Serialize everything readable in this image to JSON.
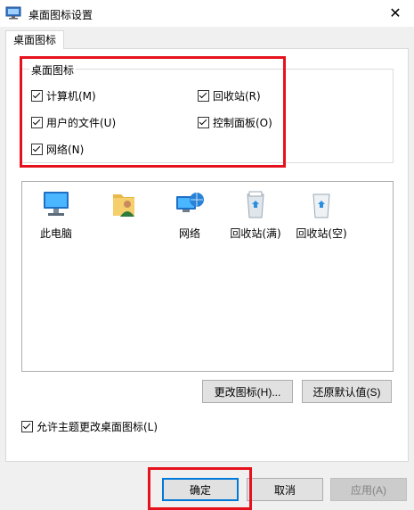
{
  "window": {
    "title": "桌面图标设置",
    "close_glyph": "✕"
  },
  "tabs": [
    {
      "label": "桌面图标",
      "selected": true
    }
  ],
  "group": {
    "legend": "桌面图标",
    "checkboxes": [
      {
        "label": "计算机(M)",
        "checked": true
      },
      {
        "label": "回收站(R)",
        "checked": true
      },
      {
        "label": "用户的文件(U)",
        "checked": true
      },
      {
        "label": "控制面板(O)",
        "checked": true
      },
      {
        "label": "网络(N)",
        "checked": true
      }
    ]
  },
  "icons": [
    {
      "label": "此电脑",
      "icon": "computer-icon"
    },
    {
      "label": "",
      "icon": "user-folder-icon"
    },
    {
      "label": "网络",
      "icon": "network-icon"
    },
    {
      "label": "回收站(满)",
      "icon": "recycle-bin-full-icon"
    },
    {
      "label": "回收站(空)",
      "icon": "recycle-bin-empty-icon"
    }
  ],
  "actions": {
    "change_icon": "更改图标(H)...",
    "restore_default": "还原默认值(S)"
  },
  "allow_themes": {
    "label": "允许主题更改桌面图标(L)",
    "checked": true
  },
  "footer": {
    "ok": "确定",
    "cancel": "取消",
    "apply": "应用(A)",
    "apply_disabled": true
  },
  "colors": {
    "highlight": "#e5121d",
    "accent": "#0078d7"
  }
}
